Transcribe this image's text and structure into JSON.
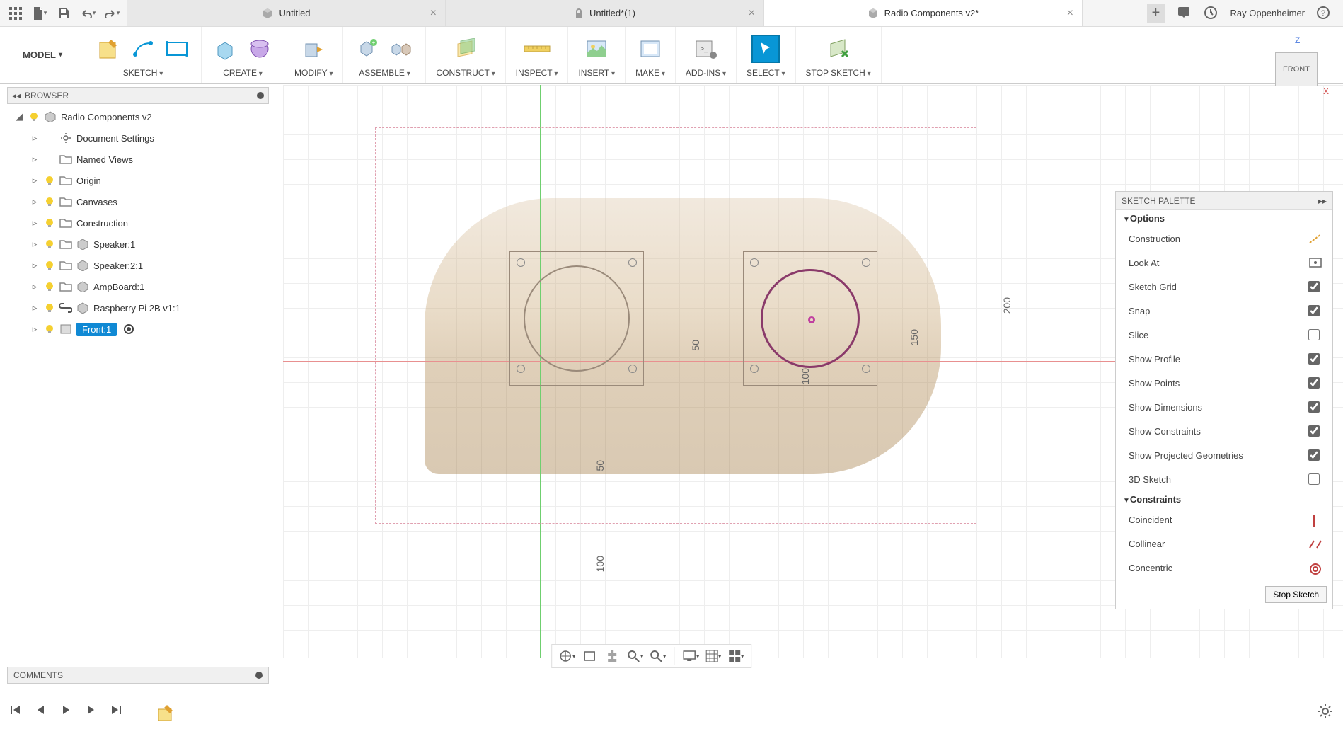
{
  "tabs": [
    {
      "label": "Untitled",
      "active": false,
      "locked": false
    },
    {
      "label": "Untitled*(1)",
      "active": false,
      "locked": true
    },
    {
      "label": "Radio Components v2*",
      "active": true,
      "locked": false
    }
  ],
  "user_name": "Ray Oppenheimer",
  "workspace": "MODEL",
  "ribbon_groups": [
    {
      "label": "SKETCH"
    },
    {
      "label": "CREATE"
    },
    {
      "label": "MODIFY"
    },
    {
      "label": "ASSEMBLE"
    },
    {
      "label": "CONSTRUCT"
    },
    {
      "label": "INSPECT"
    },
    {
      "label": "INSERT"
    },
    {
      "label": "MAKE"
    },
    {
      "label": "ADD-INS"
    },
    {
      "label": "SELECT"
    },
    {
      "label": "STOP SKETCH"
    }
  ],
  "browser_title": "BROWSER",
  "browser_root": "Radio Components v2",
  "browser_items": [
    {
      "name": "Document Settings",
      "icon": "gear"
    },
    {
      "name": "Named Views",
      "icon": "folder"
    },
    {
      "name": "Origin",
      "icon": "folder",
      "bulb": true
    },
    {
      "name": "Canvases",
      "icon": "folder",
      "bulb": true
    },
    {
      "name": "Construction",
      "icon": "folder",
      "bulb": true
    },
    {
      "name": "Speaker:1",
      "icon": "folder",
      "bulb": true
    },
    {
      "name": "Speaker:2:1",
      "icon": "folder",
      "bulb": true
    },
    {
      "name": "AmpBoard:1",
      "icon": "folder",
      "bulb": true
    },
    {
      "name": "Raspberry Pi 2B v1:1",
      "icon": "link",
      "bulb": true
    },
    {
      "name": "Front:1",
      "icon": "sketch",
      "bulb": true,
      "selected": true,
      "radio": true
    }
  ],
  "viewcube_face": "FRONT",
  "viewcube_axes": {
    "z": "Z",
    "x": "X"
  },
  "dimensions": {
    "d50a": "50",
    "d100a": "100",
    "d150": "150",
    "d200": "200",
    "d50b": "50",
    "d100b": "100"
  },
  "palette_title": "SKETCH PALETTE",
  "palette_sections": {
    "options_label": "Options",
    "constraints_label": "Constraints"
  },
  "palette_options": [
    {
      "label": "Construction",
      "type": "icon",
      "icon": "construction"
    },
    {
      "label": "Look At",
      "type": "icon",
      "icon": "lookat"
    },
    {
      "label": "Sketch Grid",
      "type": "check",
      "checked": true
    },
    {
      "label": "Snap",
      "type": "check",
      "checked": true
    },
    {
      "label": "Slice",
      "type": "check",
      "checked": false
    },
    {
      "label": "Show Profile",
      "type": "check",
      "checked": true
    },
    {
      "label": "Show Points",
      "type": "check",
      "checked": true
    },
    {
      "label": "Show Dimensions",
      "type": "check",
      "checked": true
    },
    {
      "label": "Show Constraints",
      "type": "check",
      "checked": true
    },
    {
      "label": "Show Projected Geometries",
      "type": "check",
      "checked": true
    },
    {
      "label": "3D Sketch",
      "type": "check",
      "checked": false
    }
  ],
  "palette_constraints": [
    {
      "label": "Coincident",
      "icon": "coincident"
    },
    {
      "label": "Collinear",
      "icon": "collinear"
    },
    {
      "label": "Concentric",
      "icon": "concentric"
    }
  ],
  "stop_sketch_label": "Stop Sketch",
  "comments_title": "COMMENTS"
}
